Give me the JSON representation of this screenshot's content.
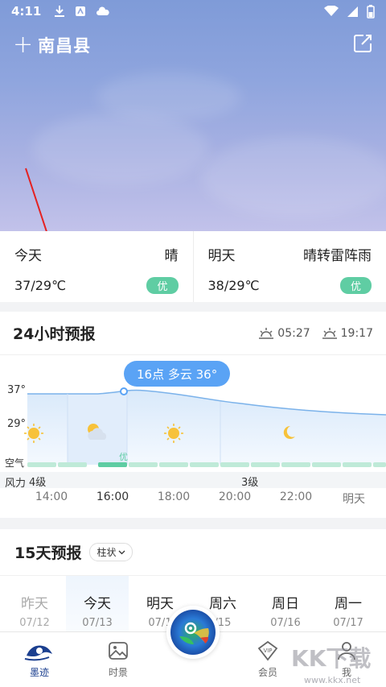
{
  "status_bar": {
    "time": "4:11"
  },
  "header": {
    "city": "南昌县",
    "add_symbol": "+"
  },
  "today_card": {
    "today": {
      "label": "今天",
      "condition": "晴",
      "temp": "37/29℃",
      "aqi": "优"
    },
    "tomorrow": {
      "label": "明天",
      "condition": "晴转雷阵雨",
      "temp": "38/29℃",
      "aqi": "优"
    }
  },
  "hourly": {
    "title": "24小时预报",
    "sunrise": "05:27",
    "sunset": "19:17",
    "tooltip": "16点 多云 36°",
    "y_labels": [
      "37°",
      "29°"
    ],
    "air_label": "空气",
    "air_value": "优",
    "wind_label": "风力",
    "wind_values": [
      "4级",
      "3级"
    ],
    "x_labels": [
      "14:00",
      "16:00",
      "18:00",
      "20:00",
      "22:00",
      "明天"
    ]
  },
  "fifteen_day": {
    "title": "15天预报",
    "mode": "柱状",
    "days": [
      {
        "name": "昨天",
        "date": "07/12"
      },
      {
        "name": "今天",
        "date": "07/13"
      },
      {
        "name": "明天",
        "date": "07/1"
      },
      {
        "name": "周六",
        "date": "/15"
      },
      {
        "name": "周日",
        "date": "07/16"
      },
      {
        "name": "周一",
        "date": "07/17"
      }
    ]
  },
  "bottom_nav": {
    "items": [
      {
        "label": "墨迹"
      },
      {
        "label": "时景"
      },
      {
        "label": "会员"
      },
      {
        "label": "我"
      }
    ]
  },
  "watermark": {
    "text": "KK下载",
    "url": "www.kkx.net"
  },
  "colors": {
    "accent": "#5aa3f5",
    "aqi_good": "#5fcda3",
    "nav_active": "#1b3f8f"
  }
}
